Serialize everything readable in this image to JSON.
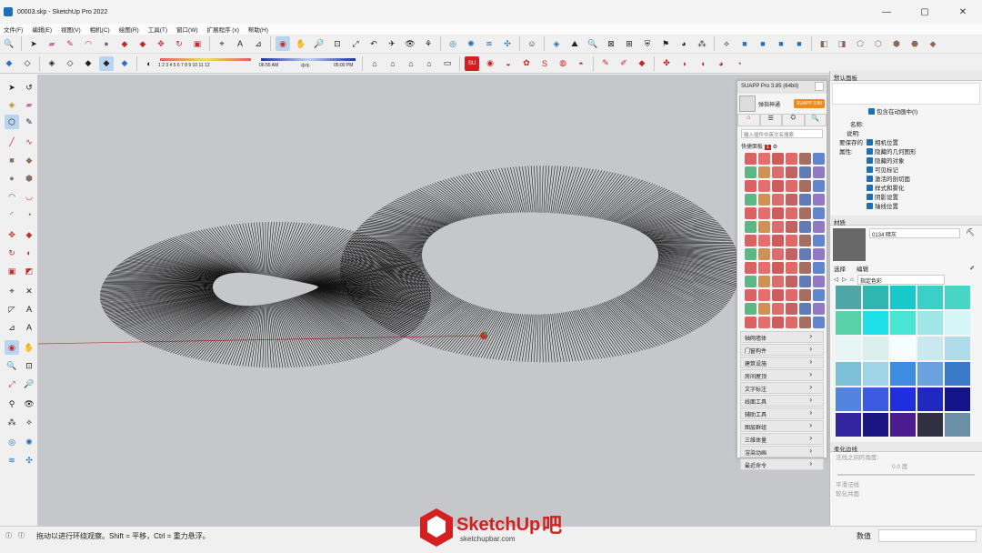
{
  "window": {
    "title": "00003.skp - SketchUp Pro 2022",
    "minimize": "—",
    "maximize": "▢",
    "close": "✕"
  },
  "menu": [
    "文件(F)",
    "编辑(E)",
    "视图(V)",
    "相机(C)",
    "绘图(R)",
    "工具(T)",
    "窗口(W)",
    "扩展程序 (x)",
    "帮助(H)"
  ],
  "shadow_toolbar": {
    "months": "1 2 3 4 5 6 7 8 9 10 11 12",
    "time_start": "06:55 AM",
    "time_mid": "中午",
    "time_end": "05:00 PM"
  },
  "status": {
    "hint": "拖动以进行环绕观察。Shift = 平移，Ctrl = 重力悬浮。",
    "value_label": "数值",
    "value": ""
  },
  "suapp": {
    "title": "SUAPP Pro 3.85 (64bit)",
    "user": "弹指神通",
    "badge": "SUAPP 3.85",
    "search_placeholder": "输入插件中英文名搜索",
    "quick_panel": "快捷面板",
    "quick_count": "1",
    "categories": [
      "轴网墙体",
      "门窗构件",
      "建筑设施",
      "房间屋顶",
      "文字标注",
      "线面工具",
      "辅助工具",
      "图层群组",
      "三维体量",
      "渲染动画",
      "最近命令"
    ]
  },
  "right_panel": {
    "default_panel": "默认面板",
    "include_anim": "包含在动画中(I)",
    "name_label": "名称:",
    "desc_label": "说明:",
    "saved_props_label": "要保存的属性:",
    "properties": [
      "相机位置",
      "隐藏的几何图形",
      "隐藏的对象",
      "可见标记",
      "激活的剖切面",
      "样式和雾化",
      "阴影设置",
      "轴线位置"
    ],
    "materials_header": "材质",
    "material_name": "0134 暗灰",
    "tab_select": "选择",
    "tab_edit": "编辑",
    "collection": "指定色彩",
    "soften_header": "柔化边线",
    "normals_label": "法线之间的角度:",
    "angle_value": "0.0 度",
    "smooth_normals": "平滑法线",
    "soften_coplanar": "软化共面"
  },
  "colors": {
    "swatches": [
      "#4fa6a6",
      "#30b5b0",
      "#18c9c9",
      "#3ad0c8",
      "#48d5c5",
      "#59d2a9",
      "#1de0e8",
      "#49e5d4",
      "#a1e6e6",
      "#d5f6f6",
      "#e8f5f5",
      "#dcefef",
      "#f6fdfd",
      "#cbe7f0",
      "#b0dbe8",
      "#7dbfd6",
      "#9fd3e6",
      "#3e8ce0",
      "#6aa2e0",
      "#3a78c8",
      "#5283dd",
      "#3d5be0",
      "#1f2fe0",
      "#2028c0",
      "#14148a",
      "#3324a0",
      "#1a1580",
      "#4a1c90",
      "#303040",
      "#6a90a8"
    ],
    "viewport_bg": "#c6c7ca",
    "material_preview": "#686868"
  },
  "watermark": {
    "brand": "SketchUp",
    "suffix": "吧",
    "url": "sketchupbar.com"
  }
}
